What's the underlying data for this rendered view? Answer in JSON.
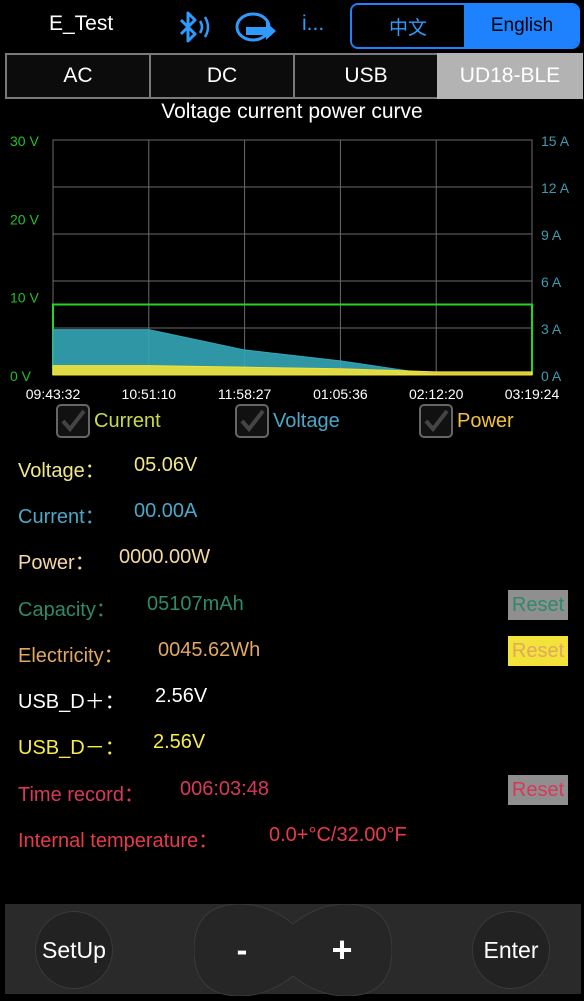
{
  "header": {
    "title": "E_Test",
    "more": "i...",
    "lang_zh": "中文",
    "lang_en": "English",
    "icons": [
      "bluetooth-icon",
      "refresh-icon"
    ],
    "accent": "#1e82ff"
  },
  "tabs": [
    {
      "label": "AC",
      "active": false
    },
    {
      "label": "DC",
      "active": false
    },
    {
      "label": "USB",
      "active": false
    },
    {
      "label": "UD18-BLE",
      "active": true
    }
  ],
  "chart": {
    "title": "Voltage current power curve",
    "left_ticks": [
      "30 V",
      "20 V",
      "10 V",
      "0 V"
    ],
    "right_ticks": [
      "15 A",
      "12 A",
      "9 A",
      "6 A",
      "3 A",
      "0 A"
    ],
    "x_ticks": [
      "09:43:32",
      "10:51:10",
      "11:58:27",
      "01:05:36",
      "02:12:20",
      "03:19:24"
    ],
    "colors": {
      "voltage": "#22d622",
      "current": "#34a6b8",
      "power": "#f2e23a"
    }
  },
  "chart_data": {
    "type": "area",
    "title": "Voltage current power curve",
    "xlabel": "",
    "ylabel": "",
    "ylim_left": [
      0,
      30
    ],
    "ylim_right": [
      0,
      15
    ],
    "categories": [
      "09:43:32",
      "10:51:10",
      "11:58:27",
      "01:05:36",
      "02:12:20",
      "03:19:24"
    ],
    "series": [
      {
        "name": "Voltage",
        "axis": "left",
        "color": "#22d622",
        "values": [
          9,
          9,
          9,
          9,
          9,
          9
        ]
      },
      {
        "name": "Current",
        "axis": "right",
        "color": "#34a6b8",
        "values": [
          2.9,
          2.9,
          1.6,
          0.9,
          0,
          0
        ]
      },
      {
        "name": "Power",
        "axis": "right",
        "color": "#f2e23a",
        "values": [
          0.6,
          0.6,
          0.5,
          0.4,
          0.2,
          0.2
        ]
      }
    ],
    "grid": true
  },
  "checks": [
    {
      "label": "Current",
      "color": "#c8d94a",
      "checked": true
    },
    {
      "label": "Voltage",
      "color": "#4aa8c8",
      "checked": true
    },
    {
      "label": "Power",
      "color": "#f2c23a",
      "checked": true
    }
  ],
  "readings": {
    "voltage": {
      "label": "Voltage：",
      "value": "05.06V",
      "color": "#f2e88a"
    },
    "current": {
      "label": "Current：",
      "value": "00.00A",
      "color": "#4aa8c8"
    },
    "power": {
      "label": "Power：",
      "value": "0000.00W",
      "color": "#f5d9a0"
    },
    "capacity": {
      "label": "Capacity：",
      "value": "05107mAh",
      "color": "#2e8a6a",
      "reset": "Reset"
    },
    "electricity": {
      "label": "Electricity：",
      "value": "0045.62Wh",
      "color": "#e0a860",
      "reset": "Reset"
    },
    "usb_dp": {
      "label": "USB_D＋：",
      "value": "2.56V",
      "color": "#ffffff"
    },
    "usb_dm": {
      "label": "USB_D－：",
      "value": "2.56V",
      "color": "#f6ec4a"
    },
    "time": {
      "label": "Time record：",
      "value": "006:03:48",
      "color": "#d9385a",
      "reset": "Reset"
    },
    "temp": {
      "label": "Internal temperature：",
      "value": "0.0+°C/32.00°F",
      "color": "#e83a4a"
    }
  },
  "bottom": {
    "setup": "SetUp",
    "minus": "-",
    "plus": "+",
    "enter": "Enter"
  }
}
